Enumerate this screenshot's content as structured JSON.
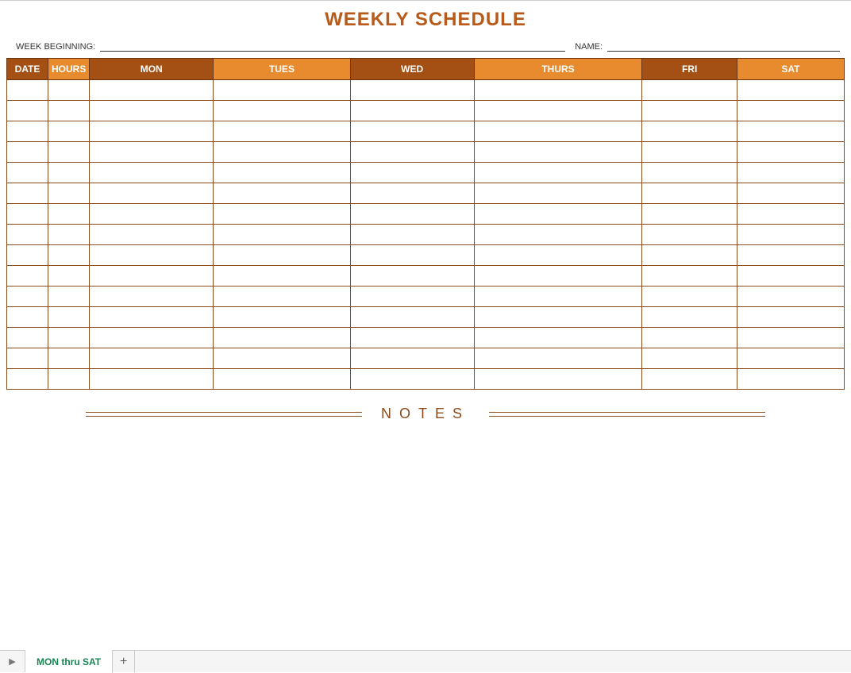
{
  "title": "WEEKLY SCHEDULE",
  "form": {
    "week_label": "WEEK BEGINNING:",
    "name_label": "NAME:"
  },
  "table": {
    "headers": {
      "date": "DATE",
      "hours": "HOURS",
      "mon": "MON",
      "tues": "TUES",
      "wed": "WED",
      "thurs": "THURS",
      "fri": "FRI",
      "sat": "SAT"
    },
    "row_count": 15
  },
  "notes_label": "NOTES",
  "tabs": {
    "nav_icon": "▶",
    "sheet1": "MON thru SAT",
    "add": "+"
  }
}
